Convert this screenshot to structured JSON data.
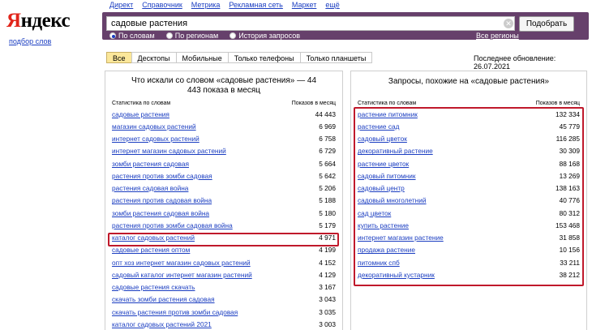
{
  "logo": {
    "first": "Я",
    "rest": "ндекс"
  },
  "logo_sub": "подбор слов",
  "topnav": [
    "Директ",
    "Справочник",
    "Метрика",
    "Рекламная сеть",
    "Маркет",
    "ещё"
  ],
  "search": {
    "value": "садовые растения",
    "button": "Подобрать"
  },
  "radios": [
    {
      "label": "По словам",
      "checked": true
    },
    {
      "label": "По регионам",
      "checked": false
    },
    {
      "label": "История запросов",
      "checked": false
    }
  ],
  "all_regions": "Все регионы",
  "tabs": [
    "Все",
    "Десктопы",
    "Мобильные",
    "Только телефоны",
    "Только планшеты"
  ],
  "updated": "Последнее обновление: 26.07.2021",
  "left": {
    "title": "Что искали со словом «садовые растения» — 44 443 показа в месяц",
    "col_query": "Статистика по словам",
    "col_count": "Показов в месяц",
    "rows": [
      {
        "q": "садовые растения",
        "n": "44 443"
      },
      {
        "q": "магазин садовых растений",
        "n": "6 969"
      },
      {
        "q": "интернет садовых растений",
        "n": "6 758"
      },
      {
        "q": "интернет магазин садовых растений",
        "n": "6 729"
      },
      {
        "q": "зомби растения садовая",
        "n": "5 664"
      },
      {
        "q": "растения против зомби садовая",
        "n": "5 642"
      },
      {
        "q": "растения садовая война",
        "n": "5 206"
      },
      {
        "q": "растения против садовая война",
        "n": "5 188"
      },
      {
        "q": "зомби растения садовая война",
        "n": "5 180"
      },
      {
        "q": "растения против зомби садовая война",
        "n": "5 179"
      },
      {
        "q": "каталог садовых растений",
        "n": "4 971"
      },
      {
        "q": "садовые растения оптом",
        "n": "4 199"
      },
      {
        "q": "опт хоз интернет магазин садовых растений",
        "n": "4 152"
      },
      {
        "q": "садовый каталог интернет магазин растений",
        "n": "4 129"
      },
      {
        "q": "садовые растения скачать",
        "n": "3 167"
      },
      {
        "q": "скачать зомби растения садовая",
        "n": "3 043"
      },
      {
        "q": "скачать растения против зомби садовая",
        "n": "3 035"
      },
      {
        "q": "каталог садовых растений 2021",
        "n": "3 003"
      }
    ]
  },
  "right": {
    "title": "Запросы, похожие на «садовые растения»",
    "col_query": "Статистика по словам",
    "col_count": "Показов в месяц",
    "rows": [
      {
        "q": "растение питомник",
        "n": "132 334"
      },
      {
        "q": "растение сад",
        "n": "45 779"
      },
      {
        "q": "садовый цветок",
        "n": "116 285"
      },
      {
        "q": "декоративный растение",
        "n": "30 309"
      },
      {
        "q": "растение цветок",
        "n": "88 168"
      },
      {
        "q": "садовый питомник",
        "n": "13 269"
      },
      {
        "q": "садовый центр",
        "n": "138 163"
      },
      {
        "q": "садовый многолетний",
        "n": "40 776"
      },
      {
        "q": "сад цветок",
        "n": "80 312"
      },
      {
        "q": "купить растение",
        "n": "153 468"
      },
      {
        "q": "интернет магазин растение",
        "n": "31 858"
      },
      {
        "q": "продажа растение",
        "n": "10 156"
      },
      {
        "q": "питомник спб",
        "n": "33 211"
      },
      {
        "q": "декоративный кустарник",
        "n": "38 212"
      }
    ]
  }
}
